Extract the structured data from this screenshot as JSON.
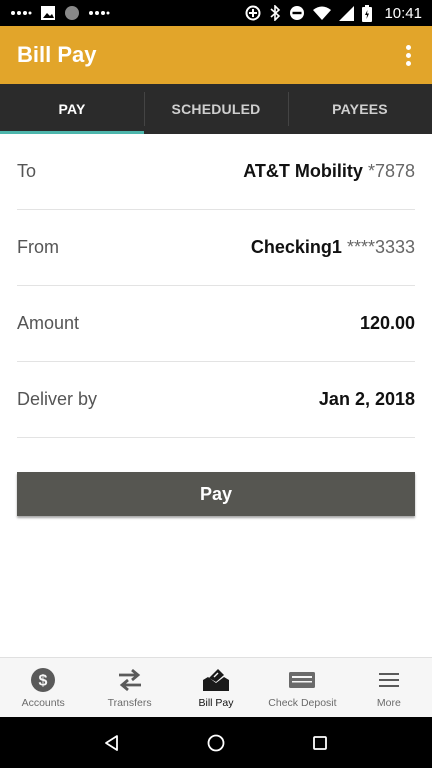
{
  "status_bar": {
    "time": "10:41",
    "left_icons": [
      "signal-dots-icon",
      "image-icon",
      "circle-icon",
      "signal-dots-icon"
    ],
    "right_icons": [
      "data-saver-icon",
      "bluetooth-icon",
      "do-not-disturb-icon",
      "wifi-icon",
      "cell-signal-icon",
      "battery-icon"
    ]
  },
  "app_bar": {
    "title": "Bill Pay",
    "menu_icon": "more-vert-icon"
  },
  "tabs": [
    {
      "label": "PAY",
      "active": true
    },
    {
      "label": "SCHEDULED",
      "active": false
    },
    {
      "label": "PAYEES",
      "active": false
    }
  ],
  "form": {
    "to": {
      "label": "To",
      "name": "AT&T Mobility",
      "mask": "*7878"
    },
    "from": {
      "label": "From",
      "name": "Checking1",
      "mask": "****3333"
    },
    "amount": {
      "label": "Amount",
      "value": "120.00"
    },
    "deliver_by": {
      "label": "Deliver by",
      "value": "Jan 2, 2018"
    }
  },
  "pay_button": {
    "label": "Pay"
  },
  "bottom_nav": [
    {
      "label": "Accounts",
      "icon": "dollar-circle-icon",
      "active": false
    },
    {
      "label": "Transfers",
      "icon": "transfer-arrows-icon",
      "active": false
    },
    {
      "label": "Bill Pay",
      "icon": "bill-pay-icon",
      "active": true
    },
    {
      "label": "Check Deposit",
      "icon": "check-deposit-icon",
      "active": false
    },
    {
      "label": "More",
      "icon": "hamburger-menu-icon",
      "active": false
    }
  ],
  "system_nav": {
    "buttons": [
      "back-icon",
      "home-icon",
      "recents-icon"
    ]
  },
  "colors": {
    "app_bar": "#E2A52A",
    "tab_bar": "#2B2B2B",
    "tab_indicator": "#4DB6AC",
    "pay_button": "#565651"
  }
}
